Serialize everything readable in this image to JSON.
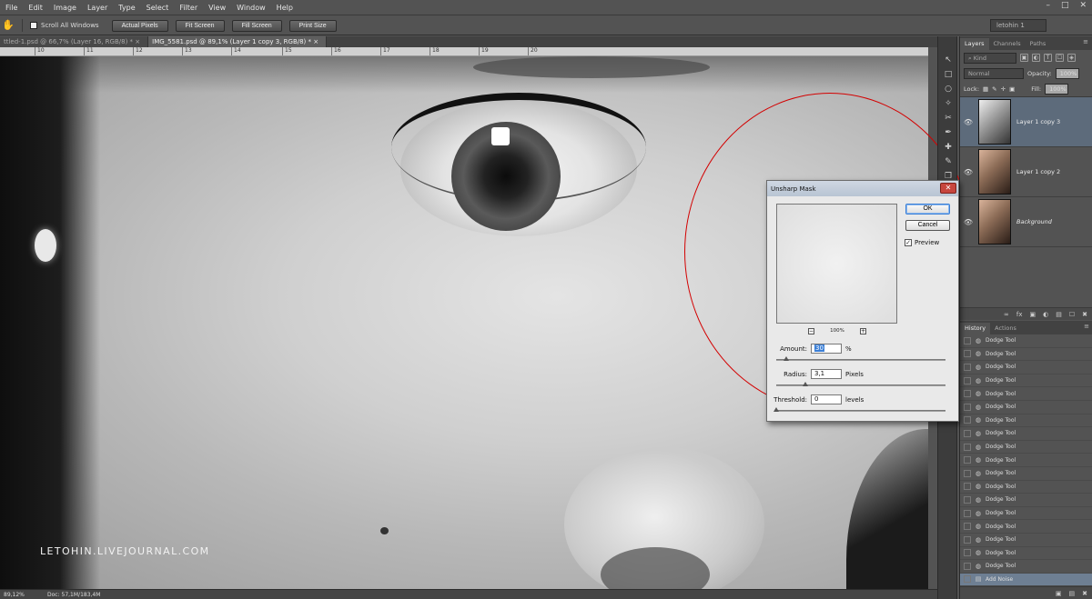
{
  "menu": [
    "File",
    "Edit",
    "Image",
    "Layer",
    "Type",
    "Select",
    "Filter",
    "View",
    "Window",
    "Help"
  ],
  "window_buttons": [
    "–",
    "□",
    "✕"
  ],
  "options": {
    "scroll_all_windows": "Scroll All Windows",
    "buttons": [
      "Actual Pixels",
      "Fit Screen",
      "Fill Screen",
      "Print Size"
    ],
    "workspace": "letohin 1"
  },
  "doc_tabs": [
    {
      "label": "ttled-1.psd @ 66,7% (Layer 16, RGB/8) *",
      "close": "×"
    },
    {
      "label": "IMG_5581.psd @ 89,1% (Layer 1 copy 3, RGB/8) *",
      "close": "×"
    }
  ],
  "ruler_ticks": [
    "10",
    "11",
    "12",
    "13",
    "14",
    "15",
    "16",
    "17",
    "18",
    "19",
    "20"
  ],
  "watermark": "LETOHIN.LIVEJOURNAL.COM",
  "status": {
    "zoom": "89,12%",
    "doc": "Doc: 57,1M/183,4M"
  },
  "tools": [
    "↖",
    "□",
    "○",
    "✧",
    "✂",
    "✒",
    "✚",
    "✎",
    "❐",
    "◐",
    "◆"
  ],
  "layers_panel": {
    "tabs": [
      "Layers",
      "Channels",
      "Paths"
    ],
    "kind": "Kind",
    "filter_icons": [
      "▣",
      "◐",
      "T",
      "☐",
      "◈"
    ],
    "blend_mode": "Normal",
    "opacity_label": "Opacity:",
    "opacity_value": "100%",
    "lock_label": "Lock:",
    "lock_icons": [
      "▦",
      "✎",
      "✛",
      "▣"
    ],
    "fill_label": "Fill:",
    "fill_value": "100%",
    "layers": [
      {
        "name": "Layer 1 copy 3",
        "selected": true
      },
      {
        "name": "Layer 1 copy 2",
        "selected": false
      },
      {
        "name": "Background",
        "selected": false
      }
    ],
    "footer_icons": [
      "∞",
      "fx",
      "▣",
      "◐",
      "▤",
      "☐",
      "✖"
    ]
  },
  "history_panel": {
    "tabs": [
      "History",
      "Actions"
    ],
    "items": [
      "Dodge Tool",
      "Dodge Tool",
      "Dodge Tool",
      "Dodge Tool",
      "Dodge Tool",
      "Dodge Tool",
      "Dodge Tool",
      "Dodge Tool",
      "Dodge Tool",
      "Dodge Tool",
      "Dodge Tool",
      "Dodge Tool",
      "Dodge Tool",
      "Dodge Tool",
      "Dodge Tool",
      "Dodge Tool",
      "Dodge Tool",
      "Dodge Tool",
      "Add Noise"
    ],
    "footer_icons": [
      "▣",
      "▤",
      "✖"
    ]
  },
  "dialog": {
    "title": "Unsharp Mask",
    "close": "✕",
    "ok": "OK",
    "cancel": "Cancel",
    "preview_label": "Preview",
    "preview_checked": "✓",
    "zoom": "100%",
    "zoom_minus": "−",
    "zoom_plus": "+",
    "amount": {
      "label": "Amount:",
      "value": "30",
      "unit": "%",
      "level": 0.06
    },
    "radius": {
      "label": "Radius:",
      "value": "3,1",
      "unit": "Pixels",
      "level": 0.17
    },
    "threshold": {
      "label": "Threshold:",
      "value": "0",
      "unit": "levels",
      "level": 0.0
    }
  }
}
